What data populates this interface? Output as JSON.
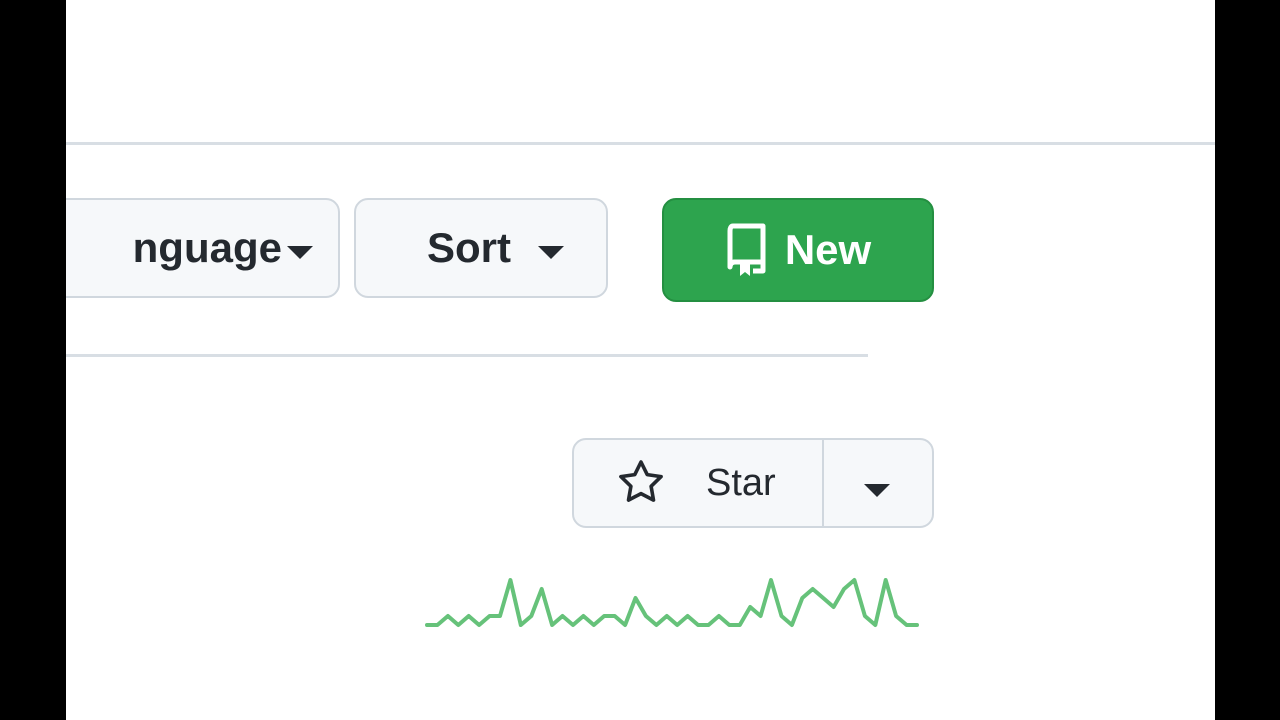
{
  "toolbar": {
    "language_label": "Language",
    "language_visible_text": "nguage",
    "sort_label": "Sort",
    "new_label": "New"
  },
  "repo_item": {
    "star_label": "Star"
  },
  "icons": {
    "language_caret": "chevron-down-icon",
    "sort_caret": "chevron-down-icon",
    "new_icon": "repo-icon",
    "star_icon": "star-icon",
    "star_caret": "chevron-down-icon",
    "cursor": "mouse-pointer-icon"
  },
  "colors": {
    "new_button_bg": "#2da44e",
    "sparkline": "#66c27a",
    "button_bg": "#f6f8fa",
    "border": "#d0d7de"
  },
  "sparkline": {
    "values": [
      1,
      1,
      2,
      1,
      2,
      1,
      2,
      2,
      6,
      1,
      2,
      5,
      1,
      2,
      1,
      2,
      1,
      2,
      2,
      1,
      4,
      2,
      1,
      2,
      1,
      2,
      1,
      1,
      2,
      1,
      1,
      3,
      2,
      6,
      2,
      1,
      4,
      5,
      4,
      3,
      5,
      6,
      2,
      1,
      6,
      2,
      1,
      1
    ]
  }
}
